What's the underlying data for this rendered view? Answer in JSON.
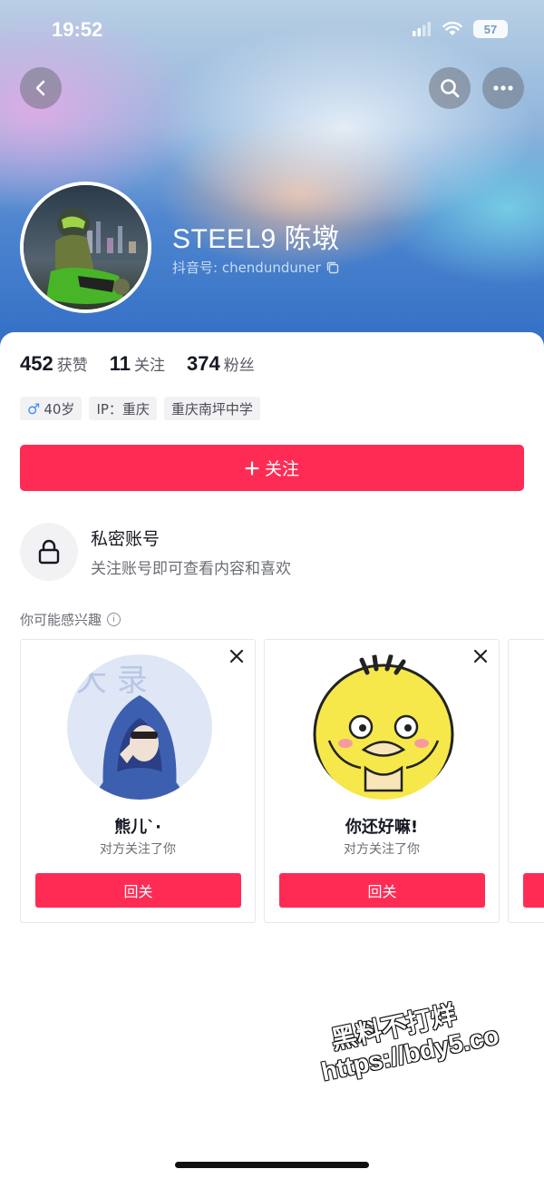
{
  "status_bar": {
    "time": "19:52",
    "battery": "57"
  },
  "profile": {
    "name": "STEEL9 陈墩",
    "douyin_id": "抖音号: chendunduner"
  },
  "stats": [
    {
      "value": "452",
      "label": "获赞"
    },
    {
      "value": "11",
      "label": "关注"
    },
    {
      "value": "374",
      "label": "粉丝"
    }
  ],
  "tags": {
    "gender_symbol": "♂",
    "age": "40岁",
    "ip": "IP：重庆",
    "school": "重庆南坪中学"
  },
  "follow_button": {
    "label": "关注"
  },
  "private_account": {
    "title": "私密账号",
    "subtitle": "关注账号即可查看内容和喜欢"
  },
  "suggestions": {
    "heading": "你可能感兴趣",
    "items": [
      {
        "name": "熊儿`·",
        "subtitle": "对方关注了你",
        "button": "回关"
      },
      {
        "name": "你还好嘛!",
        "subtitle": "对方关注了你",
        "button": "回关"
      }
    ]
  },
  "watermark": {
    "line1": "黑料不打烊",
    "line2": "https://bdy5.co"
  },
  "colors": {
    "accent": "#fe2c55",
    "hero_blue": "#2f6cc4"
  },
  "icons": [
    "back-icon",
    "search-icon",
    "more-icon",
    "copy-icon",
    "lock-icon",
    "info-icon",
    "close-icon",
    "plus-icon",
    "signal-icon",
    "wifi-icon",
    "battery-icon"
  ]
}
